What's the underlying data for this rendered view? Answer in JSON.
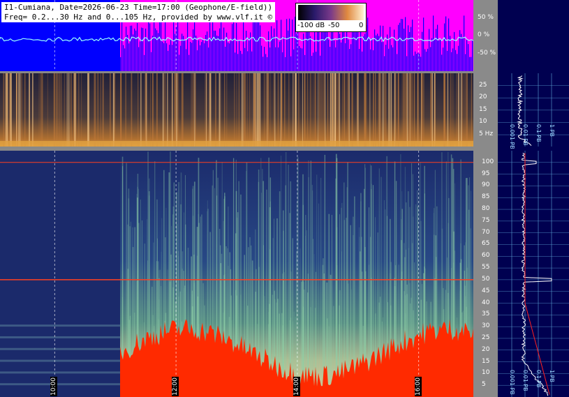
{
  "title_line1": "I1-Cumiana, Date=2026-06-23 Time=17:00 (Geophone/E-field))",
  "title_line2": "Freq= 0.2...30 Hz and 0...105 Hz, provided by www.vlf.it ©",
  "colorbar": {
    "min_label": "-100 dB",
    "mid_label": "-50",
    "max_label": "0"
  },
  "colors": {
    "blue": "#0000ff",
    "magenta": "#ff00ff",
    "red": "#ff2a00",
    "dark_navy": "#1b2a6b",
    "side_bg": "#000050"
  },
  "chart_data": [
    {
      "type": "area",
      "panel": "level-strip",
      "y_ticks": [
        "50 %",
        "0 %",
        "-50 %"
      ],
      "yticks_values": [
        50,
        0,
        -50
      ],
      "ylim": [
        -100,
        100
      ]
    },
    {
      "type": "heatmap",
      "panel": "low-frequency-spectrogram",
      "y_unit_label": "Hz",
      "y_ticks": [
        "25",
        "20",
        "15",
        "10",
        "5 Hz"
      ],
      "yticks_values": [
        25,
        20,
        15,
        10,
        5
      ],
      "ylim": [
        0.2,
        30
      ]
    },
    {
      "type": "heatmap",
      "panel": "spectrogram-0-105Hz",
      "y_ticks": [
        "100",
        "95",
        "90",
        "85",
        "80",
        "75",
        "70",
        "65",
        "60",
        "55",
        "50",
        "45",
        "40",
        "35",
        "30",
        "25",
        "20",
        "15",
        "10",
        "5"
      ],
      "yticks_values": [
        100,
        95,
        90,
        85,
        80,
        75,
        70,
        65,
        60,
        55,
        50,
        45,
        40,
        35,
        30,
        25,
        20,
        15,
        10,
        5
      ],
      "ylim": [
        0,
        105
      ],
      "x_ticks": [
        "10:00",
        "12:00",
        "14:00",
        "16:00"
      ],
      "xticks_values": [
        10,
        12,
        14,
        16
      ],
      "xlim": [
        9.1,
        16.9
      ]
    },
    {
      "type": "line",
      "panel": "side-spectrum-low",
      "bottom_labels": [
        "0.001 PB",
        "0.01 PB",
        "0.1 PB",
        "1 PB"
      ]
    },
    {
      "type": "line",
      "panel": "side-spectrum-main",
      "bottom_labels": [
        "0.001 PB",
        "0.01 PB",
        "0.1 PB",
        "1 PB"
      ]
    }
  ]
}
